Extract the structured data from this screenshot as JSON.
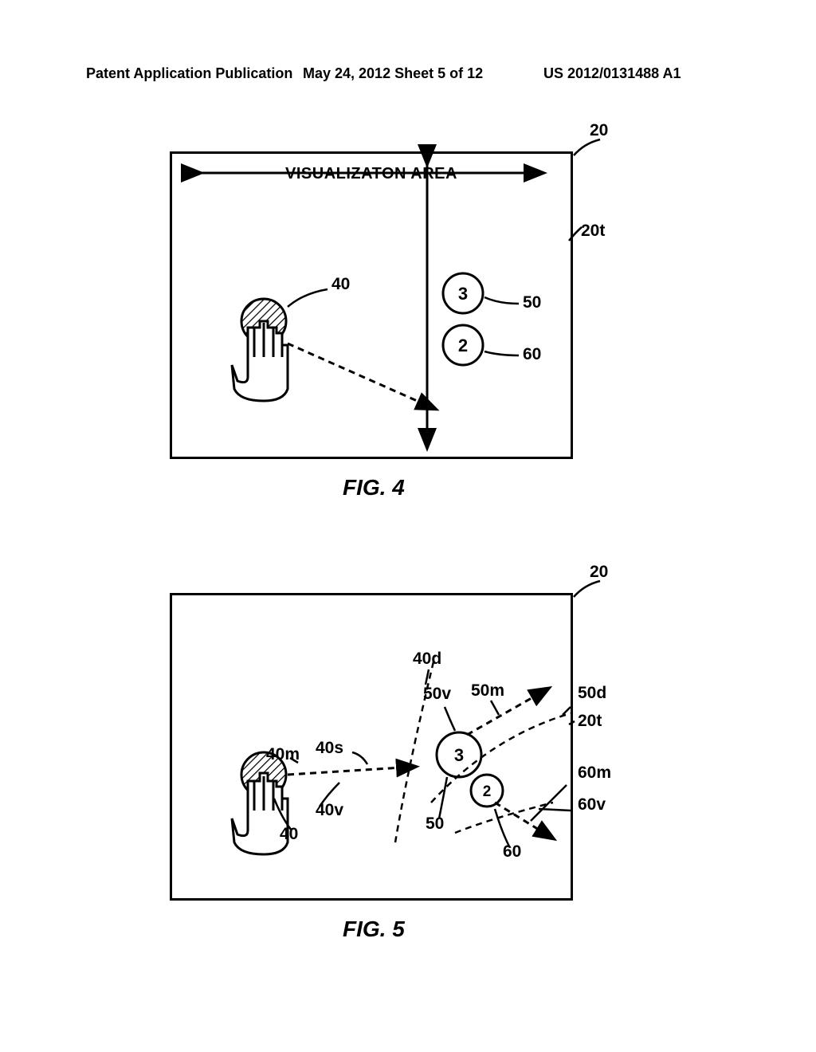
{
  "header": {
    "left": "Patent Application Publication",
    "center": "May 24, 2012  Sheet 5 of 12",
    "right": "US 2012/0131488 A1"
  },
  "fig4": {
    "caption": "FIG. 4",
    "viz_label": "VISUALIZATON AREA",
    "ref_20": "20",
    "ref_20t": "20t",
    "ref_40": "40",
    "ref_50": "50",
    "ref_60": "60",
    "circle3_text": "3",
    "circle2_text": "2"
  },
  "fig5": {
    "caption": "FIG. 5",
    "ref_20": "20",
    "ref_20t": "20t",
    "ref_40": "40",
    "ref_40m": "40m",
    "ref_40s": "40s",
    "ref_40v": "40v",
    "ref_40d": "40d",
    "ref_50": "50",
    "ref_50v": "50v",
    "ref_50m": "50m",
    "ref_50d": "50d",
    "ref_60": "60",
    "ref_60m": "60m",
    "ref_60v": "60v",
    "circle3_text": "3",
    "circle2_text": "2"
  }
}
